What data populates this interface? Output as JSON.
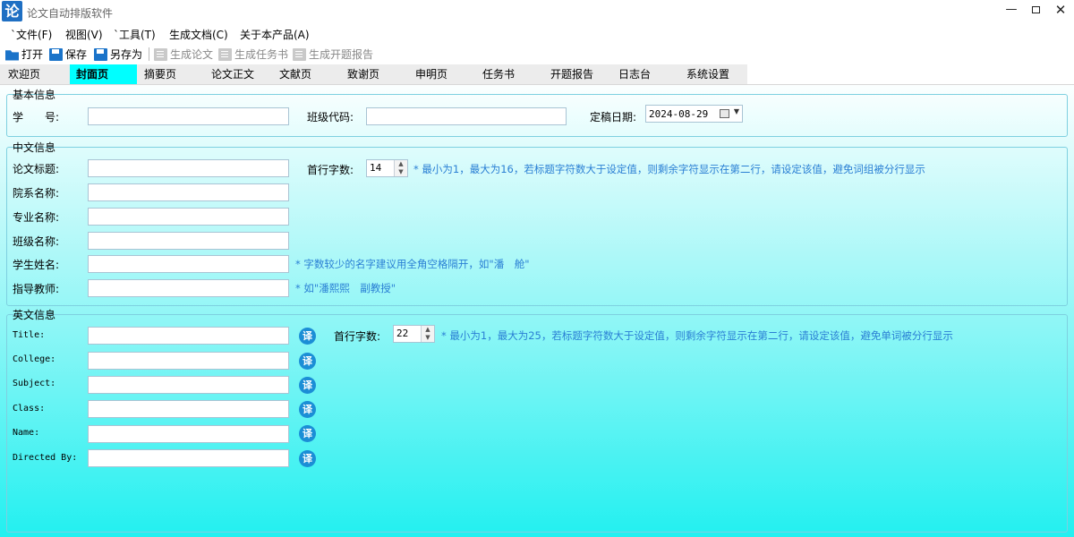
{
  "window": {
    "app_icon_glyph": "论",
    "title": "论文自动排版软件",
    "min_glyph": "—",
    "close_glyph": "✕"
  },
  "menu": [
    {
      "label": "`文件(F)"
    },
    {
      "label": "视图(V)"
    },
    {
      "label": "`工具(T)"
    },
    {
      "label": "生成文档(C)"
    },
    {
      "label": "关于本产品(A)"
    }
  ],
  "toolbar": {
    "open": "打开",
    "save": "保存",
    "save_as": "另存为",
    "gen_thesis": "生成论文",
    "gen_task": "生成任务书",
    "gen_proposal": "生成开题报告"
  },
  "tabs": [
    {
      "label": "欢迎页"
    },
    {
      "label": "封面页"
    },
    {
      "label": "摘要页"
    },
    {
      "label": "论文正文"
    },
    {
      "label": "文献页"
    },
    {
      "label": "致谢页"
    },
    {
      "label": "申明页"
    },
    {
      "label": "任务书"
    },
    {
      "label": "开题报告"
    },
    {
      "label": "日志台"
    },
    {
      "label": "系统设置"
    }
  ],
  "active_tab": "封面页",
  "basic": {
    "legend": "基本信息",
    "student_id_label": "学　　号:",
    "class_code_label": "班级代码:",
    "date_label": "定稿日期:",
    "date_value": "2024-08-29"
  },
  "chinese": {
    "legend": "中文信息",
    "title_label": "论文标题:",
    "dept_label": "院系名称:",
    "major_label": "专业名称:",
    "class_label": "班级名称:",
    "student_label": "学生姓名:",
    "teacher_label": "指导教师:",
    "first_line_label": "首行字数:",
    "first_line_value": "14",
    "first_line_hint": "* 最小为1，最大为16，若标题字符数大于设定值，则剩余字符显示在第二行，请设定该值，避免词组被分行显示",
    "student_hint": "* 字数较少的名字建议用全角空格隔开，如\"潘　舱\"",
    "teacher_hint": "* 如\"潘熙熙　副教授\""
  },
  "english": {
    "legend": "英文信息",
    "title_label": "Title:",
    "college_label": "College:",
    "subject_label": "Subject:",
    "class_label": "Class:",
    "name_label": "Name:",
    "directed_label": "Directed By:",
    "first_line_label": "首行字数:",
    "first_line_value": "22",
    "first_line_hint": "* 最小为1，最大为25，若标题字符数大于设定值，则剩余字符显示在第二行，请设定该值，避免单词被分行显示",
    "translate_glyph": "译"
  },
  "colors": {
    "accent": "#1b8ed6",
    "active_tab": "#00ffff",
    "hint": "#2a7fd4"
  }
}
